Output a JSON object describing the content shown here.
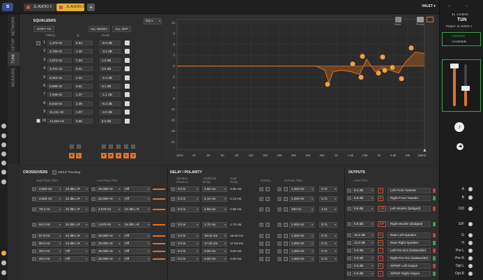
{
  "tabs": [
    {
      "label": "JL AUDIO 2",
      "active": false
    },
    {
      "label": "JL AUDIO 1",
      "active": true
    }
  ],
  "add_tab_label": "+",
  "preset_label": "VALET",
  "brand": {
    "line1": "JL AUDIO",
    "line2": "TüN",
    "project": "Project: JL AUDIO 1"
  },
  "device": {
    "model": "VX800/8i",
    "model2": "VX1000/5i"
  },
  "side_tabs": [
    "NETWORK",
    "SETUP",
    "TUNE",
    "MEASURE"
  ],
  "eq": {
    "title": "EQUALIZERS",
    "copy_to": "COPY TO",
    "all_reset": "ALL RESET",
    "all_off": "ALL OFF",
    "col_freq": "FREQ.",
    "col_q": "Q",
    "col_gain": "GAIN",
    "selector": "EQ 1",
    "rows": [
      {
        "n": "1",
        "freq": "1,470 Hz",
        "q": "5.54",
        "gain": "-6.0 dB"
      },
      {
        "n": "2",
        "freq": "2,739 Hz",
        "q": "1.20",
        "gain": "-3.2 dB"
      },
      {
        "n": "3",
        "freq": "2,973 Hz",
        "q": "7.93",
        "gain": "1.0 dB"
      },
      {
        "n": "4",
        "freq": "3,701 Hz",
        "q": "5.01",
        "gain": "3.6 dB"
      },
      {
        "n": "5",
        "freq": "6,024 Hz",
        "q": "4.22",
        "gain": "-2.4 dB"
      },
      {
        "n": "6",
        "freq": "6,699 Hz",
        "q": "6.61",
        "gain": "3.1 dB"
      },
      {
        "n": "7",
        "freq": "7,049 Hz",
        "q": "1.07",
        "gain": "-1.1 dB"
      },
      {
        "n": "8",
        "freq": "8,643 Hz",
        "q": "3.39",
        "gain": "-0.2 dB"
      },
      {
        "n": "9",
        "freq": "11,411 Hz",
        "q": "1.97",
        "gain": "-4.0 dB"
      },
      {
        "n": "10",
        "freq": "14,264 Hz",
        "q": "0.96",
        "gain": "6.0 dB"
      }
    ],
    "chips": [
      "E",
      "L",
      "F",
      "E",
      "A",
      "L",
      "S"
    ]
  },
  "graph": {
    "top_icons": [
      "Mode",
      "Panels"
    ],
    "xticks": [
      "20Hz",
      "40",
      "50",
      "60",
      "80",
      "100",
      "150",
      "200",
      "250",
      "400",
      "600",
      "1k",
      "1.6k",
      "2.5k",
      "4k",
      "6.3k",
      "10k",
      "16kHz"
    ],
    "yticks": [
      "12",
      "9",
      "6",
      "3",
      "0",
      "-3",
      "-6",
      "-9",
      "-12",
      "-15",
      "-18",
      "-21"
    ]
  },
  "crossovers": {
    "title": "CROSSOVERS",
    "hr_label": "HR/LP Tracking",
    "hp_label": "High-Pass Filter",
    "lp_label": "Low-Pass Filter",
    "rows": [
      {
        "hp_f": "2,500 Hz",
        "hp_s": "24 dB L-R",
        "lp_f": "20,000 Hz",
        "lp_s": "Off"
      },
      {
        "hp_f": "2,500 Hz",
        "hp_s": "24 dB L-R",
        "lp_f": "20,000 Hz",
        "lp_s": "Off"
      },
      {
        "hp_f": "78.3 Hz",
        "hp_s": "24 dB L-R",
        "lp_f": "2,679 Hz",
        "lp_s": "24 dB L-R"
      },
      {
        "hp_f": "84.0 Hz",
        "hp_s": "24 dB L-R",
        "lp_f": "2,679 Hz",
        "lp_s": "24 dB L-R"
      },
      {
        "hp_f": "87.9 Hz",
        "hp_s": "24 dB L-R",
        "lp_f": "20,000 Hz",
        "lp_s": "Off"
      },
      {
        "hp_f": "90.6 Hz",
        "hp_s": "24 dB L-R",
        "lp_f": "20,000 Hz",
        "lp_s": "Off"
      },
      {
        "hp_f": "20.0 Hz",
        "hp_s": "Off",
        "lp_f": "20,000 Hz",
        "lp_s": "Off"
      },
      {
        "hp_f": "20.0 Hz",
        "hp_s": "Off",
        "lp_f": "20,000 Hz",
        "lp_s": "Off"
      }
    ]
  },
  "delay": {
    "title": "DELAY / POLARITY",
    "col_speaker": "Speaker Distance",
    "col_additional": "Additional Delay",
    "col_total": "Total Delay",
    "col_polarity": "Polarity",
    "col_allpass": "All-Pass Filter",
    "rows": [
      {
        "dist": "0.0 in",
        "add": "3.65 ms",
        "total": "3.65 ms",
        "ap_f": "1,000 Hz",
        "ap_q": "0.71"
      },
      {
        "dist": "0.0 in",
        "add": "2.14 ms",
        "total": "2.14 ms",
        "ap_f": "1,000 Hz",
        "ap_q": "0.71"
      },
      {
        "dist": "0.0 in",
        "add": "2.56 ms",
        "total": "2.56 ms",
        "ap_f": "483 Hz",
        "ap_q": "2.21"
      },
      {
        "dist": "0.0 in",
        "add": "1.70 ms",
        "total": "1.70 ms",
        "ap_f": "1,000 Hz",
        "ap_q": "0.71"
      },
      {
        "dist": "0.0 in",
        "add": "18.02 ms",
        "total": "18.02 ms",
        "ap_f": "1,000 Hz",
        "ap_q": "0.71"
      },
      {
        "dist": "0.0 in",
        "add": "17.03 ms",
        "total": "17.03 ms",
        "ap_f": "1,000 Hz",
        "ap_q": "0.71"
      },
      {
        "dist": "0.0 in",
        "add": "0.00 ms",
        "total": "0.00 ms",
        "ap_f": "1,000 Hz",
        "ap_q": "0.71"
      },
      {
        "dist": "0.0 in",
        "add": "0.00 ms",
        "total": "0.00 ms",
        "ap_f": "1,000 Hz",
        "ap_q": "0.71"
      }
    ]
  },
  "outputs": {
    "title": "OUTPUTS",
    "col_trim": "Level Trim",
    "rows": [
      {
        "trim": "9.2 dB",
        "ch": "A",
        "name": "Left Front Tweeter"
      },
      {
        "trim": "8.9 dB",
        "ch": "B",
        "name": "Right Front Tweeter"
      },
      {
        "trim": "9.9 dB",
        "ch": "C/D",
        "name": "Left Woofer (bridged)"
      },
      {
        "trim": "8.0 dB",
        "ch": "E/F",
        "name": "Right Woofer (bridged)"
      },
      {
        "trim": "10.2 dB",
        "ch": "G",
        "name": "Rear Left Speaker"
      },
      {
        "trim": "12.0 dB",
        "ch": "H",
        "name": "Rear Right Speaker"
      },
      {
        "trim": "0.0 dB",
        "ch": "I",
        "name": "Left Pre-Out (Subwoofer)"
      },
      {
        "trim": "0.0 dB",
        "ch": "J",
        "name": "Right Pre-Out (Subwoofer)"
      },
      {
        "trim": "0.0 dB",
        "ch": "K",
        "name": "S/PDIF Left Output"
      },
      {
        "trim": "0.0 dB",
        "ch": "L",
        "name": "S/PDIF Right Output"
      }
    ]
  },
  "right_labels": [
    "A",
    "B",
    "C/D",
    "E/F",
    "G",
    "H",
    "Pre L",
    "Pre R",
    "Opt L",
    "Opt R"
  ],
  "colors": {
    "accent": "#e0732a",
    "brand": "#d2533a",
    "green": "#3aa04a"
  }
}
